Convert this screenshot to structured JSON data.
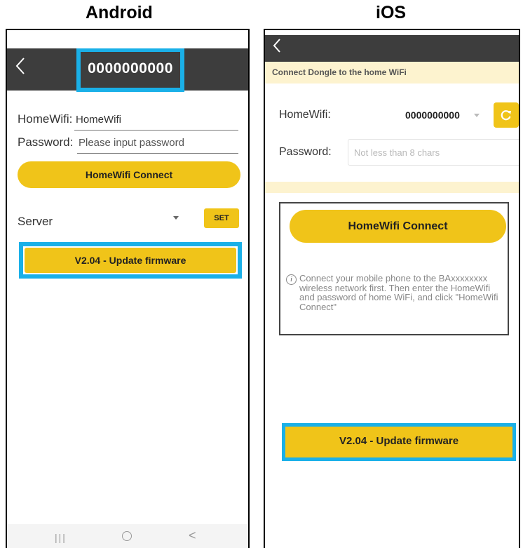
{
  "headers": {
    "android": "Android",
    "ios": "iOS"
  },
  "android": {
    "back_icon": "chevron-left-icon",
    "title": "0000000000",
    "homewifi_label": "HomeWifi:",
    "homewifi_value": "HomeWifi",
    "password_label": "Password:",
    "password_placeholder": "Please input password",
    "connect_button": "HomeWifi Connect",
    "server_label": "Server",
    "set_button": "SET",
    "firmware_button": "V2.04 -  Update firmware",
    "nav": {
      "recent": "|||",
      "back": "<"
    }
  },
  "ios": {
    "back_icon": "chevron-left-icon",
    "banner": "Connect Dongle to the home WiFi",
    "homewifi_label": "HomeWifi:",
    "homewifi_value": "0000000000",
    "refresh_icon": "refresh-icon",
    "password_label": "Password:",
    "password_placeholder": "Not less than 8 chars",
    "connect_button": "HomeWifi Connect",
    "info_text": "Connect your mobile phone to the BAxxxxxxxx wireless network first. Then enter the HomeWifi and password of home WiFi, and click \"HomeWifi Connect\"",
    "firmware_button": "V2.04 - Update firmware"
  },
  "colors": {
    "accent_yellow": "#f0c419",
    "highlight_blue": "#1ab0e8",
    "header_dark": "#3d3d3d",
    "banner_cream": "#fdf3cf"
  }
}
